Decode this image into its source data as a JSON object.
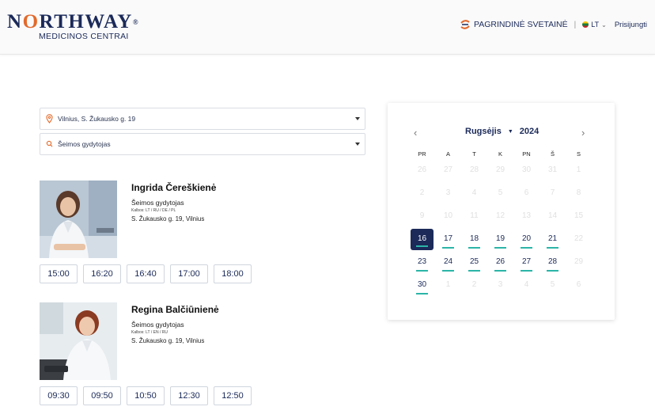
{
  "header": {
    "logo_word_pre": "N",
    "logo_word_o": "O",
    "logo_word_post": "RTHWAY",
    "logo_reg": "®",
    "logo_sub": "MEDICINOS CENTRAI",
    "main_site": "PAGRINDINĖ SVETAINĖ",
    "separator": "|",
    "lang": "LT",
    "login": "Prisijungti"
  },
  "filters": {
    "location": "Vilnius, S. Žukausko g. 19",
    "specialty": "Šeimos gydytojas"
  },
  "doctors": [
    {
      "name": "Ingrida Čereškienė",
      "specialty": "Šeimos gydytojas",
      "languages": "Kalbos: LT / RU / DE / PL",
      "address": "S. Žukausko g. 19, Vilnius",
      "times": [
        "15:00",
        "16:20",
        "16:40",
        "17:00",
        "18:00"
      ]
    },
    {
      "name": "Regina Balčiūnienė",
      "specialty": "Šeimos gydytojas",
      "languages": "Kalbos: LT / EN / RU",
      "address": "S. Žukausko g. 19, Vilnius",
      "times": [
        "09:30",
        "09:50",
        "10:50",
        "12:30",
        "12:50"
      ]
    }
  ],
  "calendar": {
    "month": "Rugsėjis",
    "year": "2024",
    "prev": "‹",
    "next": "›",
    "weekdays": [
      "PR",
      "A",
      "T",
      "K",
      "PN",
      "Š",
      "S"
    ],
    "days": [
      {
        "d": "26",
        "s": "muted"
      },
      {
        "d": "27",
        "s": "muted"
      },
      {
        "d": "28",
        "s": "muted"
      },
      {
        "d": "29",
        "s": "muted"
      },
      {
        "d": "30",
        "s": "muted"
      },
      {
        "d": "31",
        "s": "muted"
      },
      {
        "d": "1",
        "s": "muted"
      },
      {
        "d": "2",
        "s": "muted"
      },
      {
        "d": "3",
        "s": "muted"
      },
      {
        "d": "4",
        "s": "muted"
      },
      {
        "d": "5",
        "s": "muted"
      },
      {
        "d": "6",
        "s": "muted"
      },
      {
        "d": "7",
        "s": "muted"
      },
      {
        "d": "8",
        "s": "muted"
      },
      {
        "d": "9",
        "s": "muted"
      },
      {
        "d": "10",
        "s": "muted"
      },
      {
        "d": "11",
        "s": "muted"
      },
      {
        "d": "12",
        "s": "muted"
      },
      {
        "d": "13",
        "s": "muted"
      },
      {
        "d": "14",
        "s": "muted"
      },
      {
        "d": "15",
        "s": "muted"
      },
      {
        "d": "16",
        "s": "selected"
      },
      {
        "d": "17",
        "s": "available"
      },
      {
        "d": "18",
        "s": "available"
      },
      {
        "d": "19",
        "s": "available"
      },
      {
        "d": "20",
        "s": "available"
      },
      {
        "d": "21",
        "s": "available"
      },
      {
        "d": "22",
        "s": "muted"
      },
      {
        "d": "23",
        "s": "available"
      },
      {
        "d": "24",
        "s": "available"
      },
      {
        "d": "25",
        "s": "available"
      },
      {
        "d": "26",
        "s": "available"
      },
      {
        "d": "27",
        "s": "available"
      },
      {
        "d": "28",
        "s": "available"
      },
      {
        "d": "29",
        "s": "muted"
      },
      {
        "d": "30",
        "s": "available"
      },
      {
        "d": "1",
        "s": "muted"
      },
      {
        "d": "2",
        "s": "muted"
      },
      {
        "d": "3",
        "s": "muted"
      },
      {
        "d": "4",
        "s": "muted"
      },
      {
        "d": "5",
        "s": "muted"
      },
      {
        "d": "6",
        "s": "muted"
      }
    ]
  },
  "colors": {
    "brand_navy": "#1b2a59",
    "brand_orange": "#e26a2c",
    "available_underline": "#2bb5a8"
  }
}
